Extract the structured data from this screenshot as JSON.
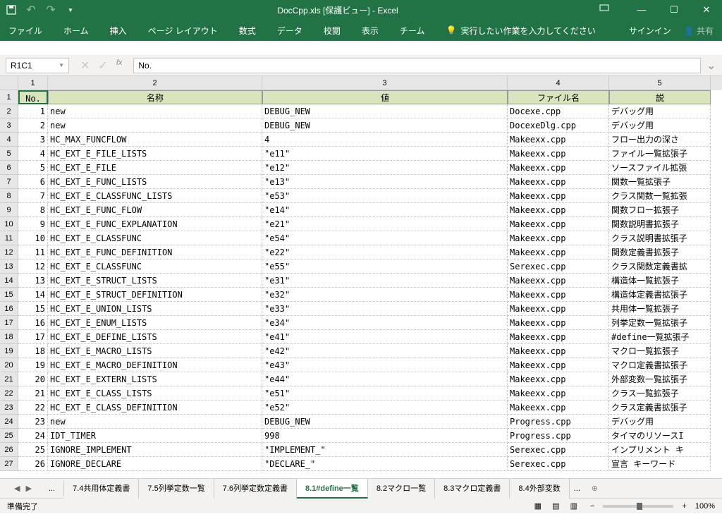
{
  "title": "DocCpp.xls [保護ビュー] - Excel",
  "ribbon": {
    "tabs": [
      "ファイル",
      "ホーム",
      "挿入",
      "ページ レイアウト",
      "数式",
      "データ",
      "校閲",
      "表示",
      "チーム"
    ],
    "tell_me": "実行したい作業を入力してください",
    "signin": "サインイン",
    "share": "共有"
  },
  "name_box": "R1C1",
  "formula": "No.",
  "col_headers": [
    "1",
    "2",
    "3",
    "4",
    "5"
  ],
  "row_headers": [
    "1",
    "2",
    "3",
    "4",
    "5",
    "6",
    "7",
    "8",
    "9",
    "10",
    "11",
    "12",
    "13",
    "14",
    "15",
    "16",
    "17",
    "18",
    "19",
    "20",
    "21",
    "22",
    "23",
    "24",
    "25",
    "26",
    "27"
  ],
  "header_row": [
    "No.",
    "名称",
    "値",
    "ファイル名",
    "説"
  ],
  "rows": [
    {
      "no": "1",
      "name": "new",
      "val": "DEBUG_NEW",
      "file": "Docexe.cpp",
      "desc": "デバッグ用"
    },
    {
      "no": "2",
      "name": "new",
      "val": "DEBUG_NEW",
      "file": "DocexeDlg.cpp",
      "desc": "デバッグ用"
    },
    {
      "no": "3",
      "name": "HC_MAX_FUNCFLOW",
      "val": "4",
      "file": "Makeexx.cpp",
      "desc": "フロー出力の深さ"
    },
    {
      "no": "4",
      "name": "HC_EXT_E_FILE_LISTS",
      "val": "\"e11\"",
      "file": "Makeexx.cpp",
      "desc": "ファイル一覧拡張子"
    },
    {
      "no": "5",
      "name": "HC_EXT_E_FILE",
      "val": "\"e12\"",
      "file": "Makeexx.cpp",
      "desc": "ソースファイル拡張"
    },
    {
      "no": "6",
      "name": "HC_EXT_E_FUNC_LISTS",
      "val": "\"e13\"",
      "file": "Makeexx.cpp",
      "desc": "関数一覧拡張子"
    },
    {
      "no": "7",
      "name": "HC_EXT_E_CLASSFUNC_LISTS",
      "val": "\"e53\"",
      "file": "Makeexx.cpp",
      "desc": "クラス関数一覧拡張"
    },
    {
      "no": "8",
      "name": "HC_EXT_E_FUNC_FLOW",
      "val": "\"e14\"",
      "file": "Makeexx.cpp",
      "desc": "関数フロー拡張子"
    },
    {
      "no": "9",
      "name": "HC_EXT_E_FUNC_EXPLANATION",
      "val": "\"e21\"",
      "file": "Makeexx.cpp",
      "desc": "関数説明書拡張子"
    },
    {
      "no": "10",
      "name": "HC_EXT_E_CLASSFUNC",
      "val": "\"e54\"",
      "file": "Makeexx.cpp",
      "desc": "クラス説明書拡張子"
    },
    {
      "no": "11",
      "name": "HC_EXT_E_FUNC_DEFINITION",
      "val": "\"e22\"",
      "file": "Makeexx.cpp",
      "desc": "関数定義書拡張子"
    },
    {
      "no": "12",
      "name": "HC_EXT_E_CLASSFUNC",
      "val": "\"e55\"",
      "file": "Serexec.cpp",
      "desc": "クラス関数定義書拡"
    },
    {
      "no": "13",
      "name": "HC_EXT_E_STRUCT_LISTS",
      "val": "\"e31\"",
      "file": "Makeexx.cpp",
      "desc": "構造体一覧拡張子"
    },
    {
      "no": "14",
      "name": "HC_EXT_E_STRUCT_DEFINITION",
      "val": "\"e32\"",
      "file": "Makeexx.cpp",
      "desc": "構造体定義書拡張子"
    },
    {
      "no": "15",
      "name": "HC_EXT_E_UNION_LISTS",
      "val": "\"e33\"",
      "file": "Makeexx.cpp",
      "desc": "共用体一覧拡張子"
    },
    {
      "no": "16",
      "name": "HC_EXT_E_ENUM_LISTS",
      "val": "\"e34\"",
      "file": "Makeexx.cpp",
      "desc": "列挙定数一覧拡張子"
    },
    {
      "no": "17",
      "name": "HC_EXT_E_DEFINE_LISTS",
      "val": "\"e41\"",
      "file": "Makeexx.cpp",
      "desc": "#define一覧拡張子"
    },
    {
      "no": "18",
      "name": "HC_EXT_E_MACRO_LISTS",
      "val": "\"e42\"",
      "file": "Makeexx.cpp",
      "desc": "マクロ一覧拡張子"
    },
    {
      "no": "19",
      "name": "HC_EXT_E_MACRO_DEFINITION",
      "val": "\"e43\"",
      "file": "Makeexx.cpp",
      "desc": "マクロ定義書拡張子"
    },
    {
      "no": "20",
      "name": "HC_EXT_E_EXTERN_LISTS",
      "val": "\"e44\"",
      "file": "Makeexx.cpp",
      "desc": "外部変数一覧拡張子"
    },
    {
      "no": "21",
      "name": "HC_EXT_E_CLASS_LISTS",
      "val": "\"e51\"",
      "file": "Makeexx.cpp",
      "desc": "クラス一覧拡張子"
    },
    {
      "no": "22",
      "name": "HC_EXT_E_CLASS_DEFINITION",
      "val": "\"e52\"",
      "file": "Makeexx.cpp",
      "desc": "クラス定義書拡張子"
    },
    {
      "no": "23",
      "name": "new",
      "val": "DEBUG_NEW",
      "file": "Progress.cpp",
      "desc": "デバッグ用"
    },
    {
      "no": "24",
      "name": "IDT_TIMER",
      "val": "998",
      "file": "Progress.cpp",
      "desc": "タイマのリソースI"
    },
    {
      "no": "25",
      "name": "IGNORE_IMPLEMENT",
      "val": "\"IMPLEMENT_\"",
      "file": "Serexec.cpp",
      "desc": "インプリメント キ"
    },
    {
      "no": "26",
      "name": "IGNORE_DECLARE",
      "val": "\"DECLARE_\"",
      "file": "Serexec.cpp",
      "desc": "宣言 キーワード"
    }
  ],
  "sheet_tabs": {
    "ellipsis": "...",
    "tabs": [
      "7.4共用体定義書",
      "7.5列挙定数一覧",
      "7.6列挙定数定義書",
      "8.1#define一覧",
      "8.2マクロ一覧",
      "8.3マクロ定義書",
      "8.4外部変数"
    ],
    "active": "8.1#define一覧",
    "more": "..."
  },
  "status": {
    "ready": "準備完了",
    "zoom": "100%"
  }
}
